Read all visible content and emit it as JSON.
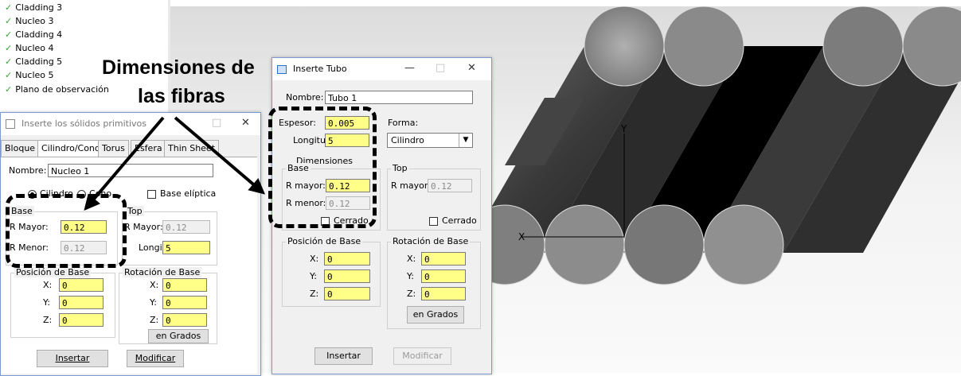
{
  "tree": {
    "items": [
      "Cladding 3",
      "Nucleo 3",
      "Cladding 4",
      "Nucleo 4",
      "Cladding 5",
      "Nucleo 5",
      "Plano de observación"
    ]
  },
  "annotation": {
    "line1": "Dimensiones de",
    "line2": "las fibras"
  },
  "viewport": {
    "axis_y": "Y",
    "axis_x": "X"
  },
  "primitives_dialog": {
    "title": "Inserte los sólidos primitivos",
    "tabs": [
      "Bloque",
      "Cilindro/Cono",
      "Torus",
      "Esfera",
      "Thin Sheet"
    ],
    "active_tab": "Cilindro/Cono",
    "nombre_label": "Nombre:",
    "nombre_value": "Nucleo 1",
    "radio_cilindro": "Cilindro",
    "radio_cono": "Cono",
    "base_eliptica": "Base elíptica",
    "base_group": "Base",
    "r_mayor_label": "R Mayor:",
    "r_mayor_value": "0.12",
    "r_menor_label": "R Menor:",
    "r_menor_value": "0.12",
    "top_group": "Top",
    "top_r_mayor_label": "R Mayor:",
    "top_r_mayor_value": "0.12",
    "longitud_label": "Longitud",
    "longitud_value": "5",
    "posicion_group": "Posición de Base",
    "rotacion_group": "Rotación de Base",
    "x_label": "X:",
    "y_label": "Y:",
    "z_label": "Z:",
    "pos_x": "0",
    "pos_y": "0",
    "pos_z": "0",
    "rot_x": "0",
    "rot_y": "0",
    "rot_z": "0",
    "en_grados": "en Grados",
    "insertar": "Insertar",
    "modificar": "Modificar"
  },
  "tubo_dialog": {
    "title": "Inserte Tubo",
    "nombre_label": "Nombre:",
    "nombre_value": "Tubo 1",
    "espesor_label": "Espesor:",
    "espesor_value": "0.005",
    "forma_label": "Forma:",
    "forma_value": "Cilindro",
    "longitud_label": "Longituc",
    "longitud_value": "5",
    "dimensiones_label": "Dimensiones",
    "base_group": "Base",
    "r_mayor_label": "R mayor:",
    "r_mayor_value": "0.12",
    "r_menor_label": "R menor:",
    "r_menor_value": "0.12",
    "cerrado_base": "Cerrado",
    "top_group": "Top",
    "top_r_mayor_label": "R mayor:",
    "top_r_mayor_value": "0.12",
    "cerrado_top": "Cerrado",
    "posicion_group": "Posición de Base",
    "rotacion_group": "Rotación de Base",
    "x_label": "X:",
    "y_label": "Y:",
    "z_label": "Z:",
    "pos_x": "0",
    "pos_y": "0",
    "pos_z": "0",
    "rot_x": "0",
    "rot_y": "0",
    "rot_z": "0",
    "en_grados": "en Grados",
    "insertar": "Insertar",
    "modificar": "Modificar"
  },
  "colors": {
    "field_yellow": "#ffff88",
    "dialog_bg": "#f0f0f0",
    "check_green": "#3aa03a"
  }
}
